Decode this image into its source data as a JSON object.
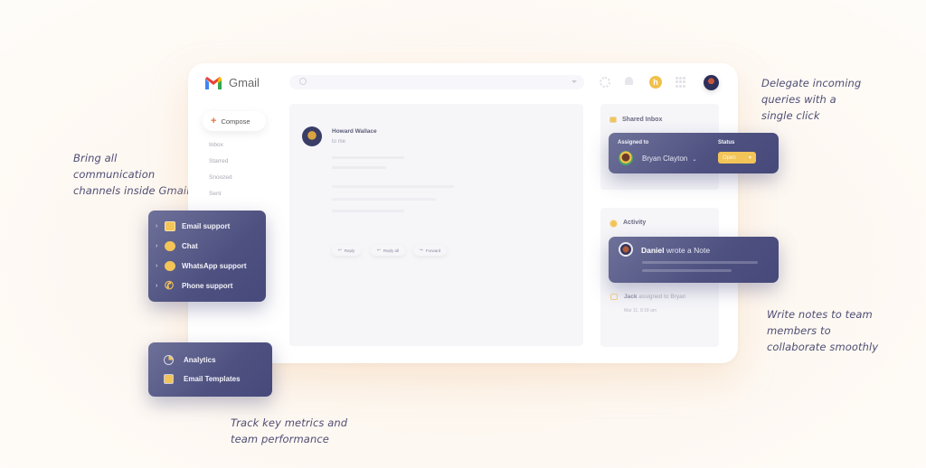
{
  "app": {
    "brand": "Gmail",
    "search": {
      "placeholder": ""
    },
    "compose_label": "Compose",
    "nav": [
      "Inbox",
      "Starred",
      "Snoozed",
      "Sent"
    ],
    "toolbar_icons": [
      "gear-icon",
      "bell-icon",
      "hiver-icon",
      "apps-icon",
      "user-avatar"
    ],
    "hiver_badge": "h"
  },
  "email": {
    "sender": "Howard Wallace",
    "to": "to me",
    "actions": [
      {
        "label": "Reply",
        "icon": "reply-icon"
      },
      {
        "label": "Reply all",
        "icon": "reply-all-icon"
      },
      {
        "label": "Forward",
        "icon": "forward-icon"
      }
    ]
  },
  "shared_inbox": {
    "title": "Shared Inbox",
    "assigned_to_label": "Assigned to",
    "assignee": "Bryan Clayton",
    "status_label": "Status",
    "status_value": "Open"
  },
  "activity": {
    "title": "Activity",
    "note_author": "Daniel",
    "note_action": "wrote a Note",
    "log_actor": "Jack",
    "log_text": "assigned to Bryan",
    "log_time": "Mar 11, 8:18 am"
  },
  "channels": [
    {
      "label": "Email support",
      "icon": "inbox-icon"
    },
    {
      "label": "Chat",
      "icon": "chat-icon"
    },
    {
      "label": "WhatsApp support",
      "icon": "whatsapp-icon"
    },
    {
      "label": "Phone support",
      "icon": "phone-icon"
    }
  ],
  "tools": [
    {
      "label": "Analytics",
      "icon": "analytics-icon"
    },
    {
      "label": "Email Templates",
      "icon": "email-templates-icon"
    }
  ],
  "annotations": {
    "channels": [
      "Bring all",
      "communication",
      "channels inside Gmail"
    ],
    "delegate": [
      "Delegate incoming",
      "queries with a",
      "single click"
    ],
    "notes": [
      "Write notes to team",
      "members to",
      "collaborate smoothly"
    ],
    "metrics": [
      "Track key metrics and",
      "team performance"
    ]
  },
  "colors": {
    "accent_yellow": "#f3c458",
    "card_purple": "#4e5180",
    "annotation_text": "#4f4d74"
  }
}
